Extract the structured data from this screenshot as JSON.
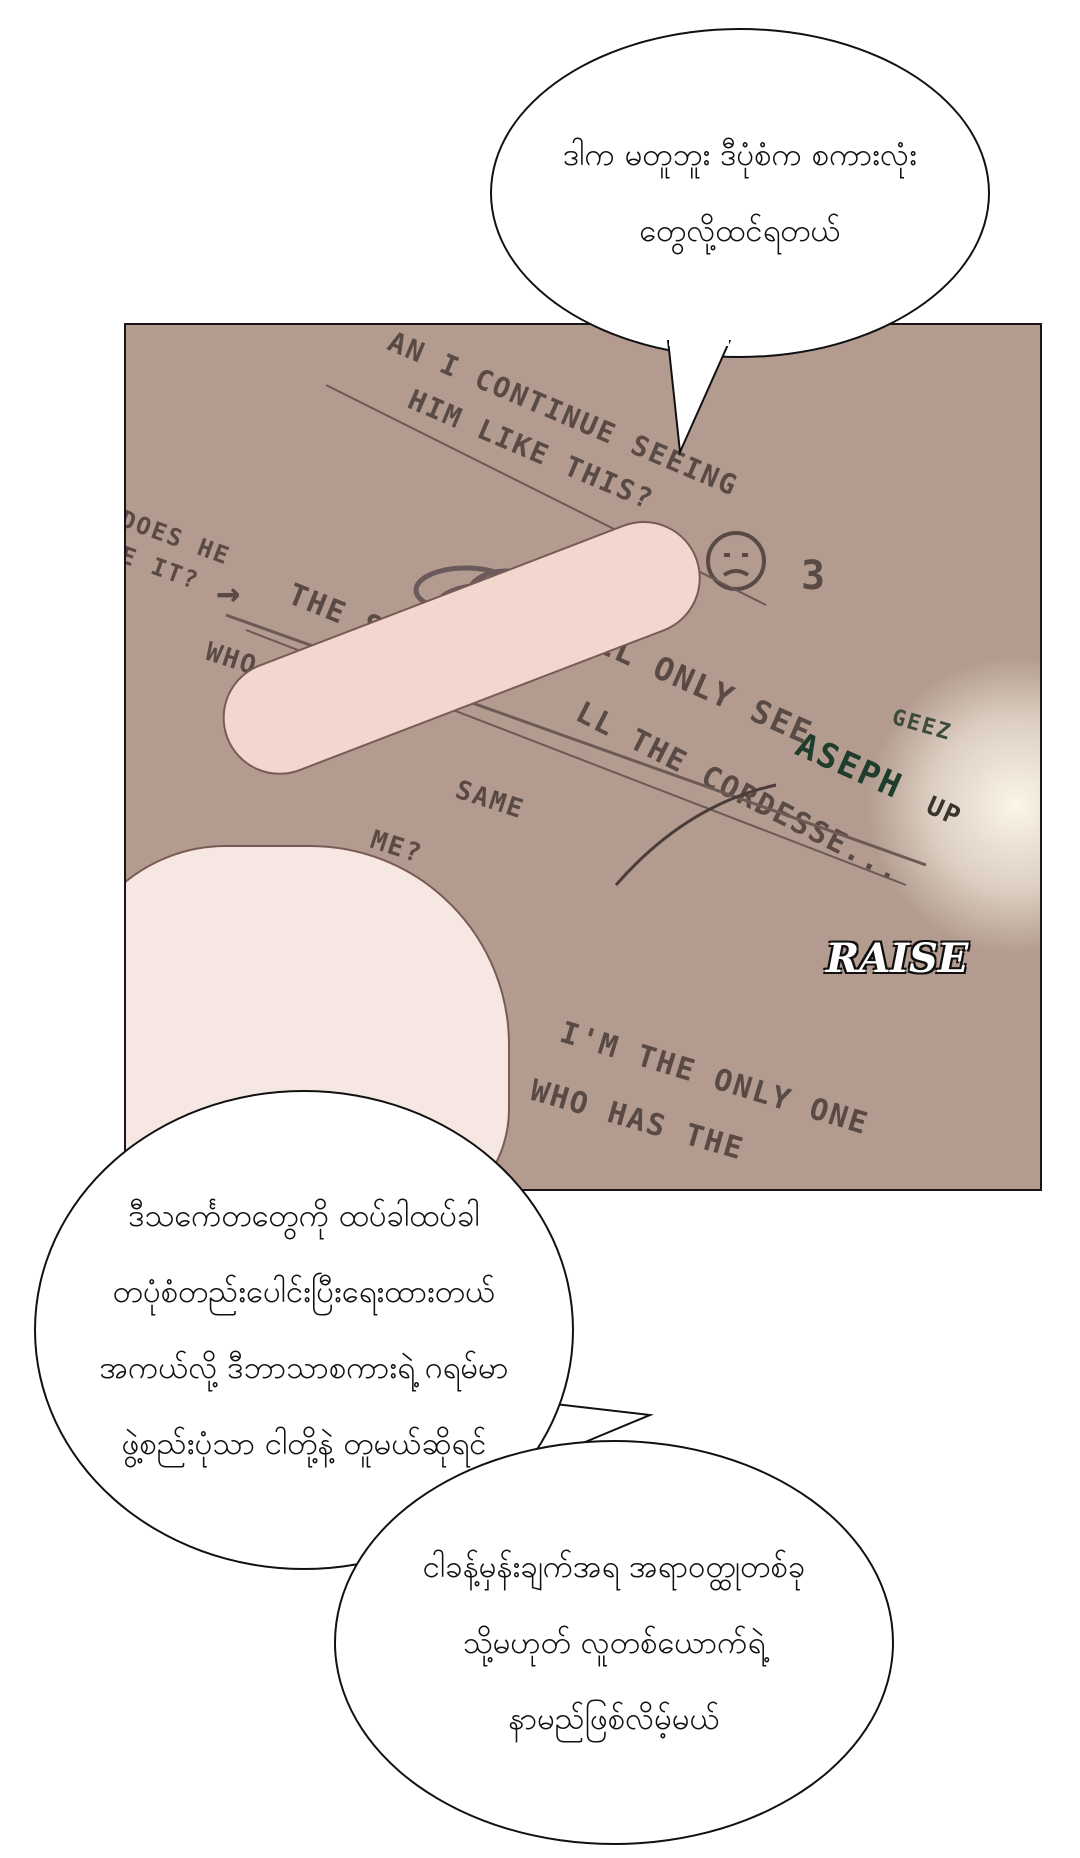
{
  "bubbles": {
    "top": {
      "lines": [
        "ဒါက မတူဘူး ဒီပုံစံက စကားလုံး",
        "တွေလို့ထင်ရတယ်"
      ]
    },
    "middle": {
      "lines": [
        "ဒီသင်္ကေတတွေကို ထပ်ခါထပ်ခါ",
        "တပုံစံတည်းပေါင်းပြီးရေးထားတယ်",
        "အကယ်လို့ ဒီဘာသာစကားရဲ့ ဂရမ်မာ",
        "ဖွဲ့စည်းပုံသာ ငါတို့နဲ့ တူမယ်ဆိုရင်"
      ]
    },
    "bottom": {
      "lines": [
        "ငါခန့်မှန်းချက်အရ အရာဝတ္ထုတစ်ခု",
        "သို့မဟုတ် လူတစ်ယောက်ရဲ့",
        "နာမည်ဖြစ်လိမ့်မယ်"
      ]
    }
  },
  "panel": {
    "notes": {
      "line1": "AN I CONTINUE SEEING",
      "line2": "HIM LIKE THIS?",
      "doesHe1": "DOES HE",
      "doesHe2": "E IT?",
      "arrow": "→",
      "theSea": "THE SEA",
      "who": "WHO",
      "onlySee": "I'LL ONLY SEE",
      "aseph": "ASEPH",
      "up": "UP",
      "geez": "GEEZ",
      "cordesse": "LL THE CORDESSE...",
      "same": "SAME",
      "me": "ME?",
      "raise": "RAISE",
      "onlyOne": "I'M THE ONLY ONE",
      "whoHas": "WHO HAS THE",
      "three": "3"
    },
    "colors": {
      "paper": "#b39c8f",
      "ink": "#5a4a46",
      "aseph": "#1f3d2c"
    }
  }
}
